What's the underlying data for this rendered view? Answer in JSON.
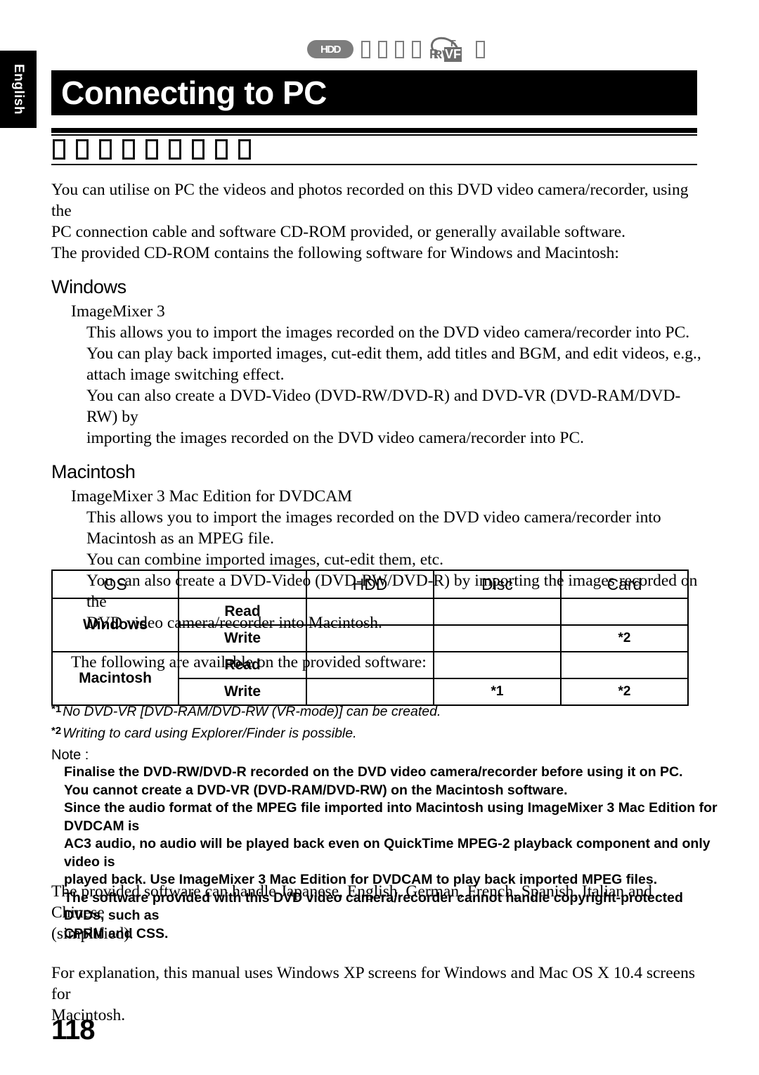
{
  "page": {
    "language_tab": "English",
    "page_number": "118"
  },
  "media_icons": [
    {
      "name": "hdd-badge-icon",
      "label": "HDD",
      "kind": "pill"
    },
    {
      "name": "media-glyph-1-icon",
      "label": "",
      "kind": "tofu"
    },
    {
      "name": "media-glyph-2-icon",
      "label": "",
      "kind": "tofu"
    },
    {
      "name": "media-glyph-3-icon",
      "label": "",
      "kind": "tofu"
    },
    {
      "name": "media-glyph-4-icon",
      "label": "",
      "kind": "tofu"
    },
    {
      "name": "dvd-ram-rw-r-vf-icon",
      "label": "R RW VF F",
      "kind": "combo"
    },
    {
      "name": "media-glyph-5-icon",
      "label": "",
      "kind": "tofu"
    }
  ],
  "header": {
    "title": "Connecting to PC"
  },
  "section_heading": {
    "glyph_count": 9,
    "note": "Heading characters are not rendered (missing glyph boxes)"
  },
  "intro": {
    "lines": [
      "You can utilise on PC the videos and photos recorded on this DVD video camera/recorder, using the",
      "PC connection cable and software CD-ROM provided, or generally available software.",
      "The provided CD-ROM contains the following software for Windows and Macintosh:"
    ]
  },
  "windows_section": {
    "heading": "Windows",
    "product": "ImageMixer 3",
    "details": [
      "This allows you to import the images recorded on the DVD video camera/recorder into PC.",
      "You can play back imported images, cut-edit them, add titles and BGM, and edit videos, e.g.,",
      "attach image switching effect.",
      "You can also create a DVD-Video (DVD-RW/DVD-R) and DVD-VR (DVD-RAM/DVD-RW) by",
      "importing the images recorded on the DVD video camera/recorder into PC."
    ]
  },
  "macintosh_section": {
    "heading": "Macintosh",
    "product": "ImageMixer 3 Mac Edition for DVDCAM",
    "details": [
      "This allows you to import the images recorded on the DVD video camera/recorder into",
      "Macintosh as an MPEG file.",
      "You can combine imported images, cut-edit them, etc.",
      "You can also create a DVD-Video (DVD-RW/DVD-R) by importing the images recorded on the",
      "DVD video camera/recorder into Macintosh."
    ]
  },
  "table_intro": "The following are available on the provided software:",
  "capability_table": {
    "columns": [
      "OS",
      "",
      "HDD",
      "Disc",
      "Card"
    ],
    "rows": [
      {
        "os": "Windows",
        "operation": "Read",
        "hdd": "",
        "disc": "",
        "card": ""
      },
      {
        "os": "Windows",
        "operation": "Write",
        "hdd": "",
        "disc": "",
        "card": "*2"
      },
      {
        "os": "Macintosh",
        "operation": "Read",
        "hdd": "",
        "disc": "",
        "card": ""
      },
      {
        "os": "Macintosh",
        "operation": "Write",
        "hdd": "",
        "disc": "*1",
        "card": "*2"
      }
    ]
  },
  "footnotes": [
    {
      "marker": "*1",
      "text": "No DVD-VR [DVD-RAM/DVD-RW (VR-mode)] can be created."
    },
    {
      "marker": "*2",
      "text": "Writing to card using Explorer/Finder is possible."
    }
  ],
  "note": {
    "label": "Note :",
    "lines": [
      "Finalise the DVD-RW/DVD-R recorded on the DVD video camera/recorder before using it on PC.",
      "You cannot create a DVD-VR (DVD-RAM/DVD-RW) on the Macintosh software.",
      "Since the audio format of the MPEG file imported into Macintosh using ImageMixer 3 Mac Edition for DVDCAM is",
      "AC3 audio, no audio will be played back even on QuickTime MPEG-2 playback component and only video is",
      "played back. Use ImageMixer 3 Mac Edition for DVDCAM to play back imported MPEG files.",
      "The software provided with this DVD video camera/recorder cannot handle copyright-protected DVDs, such as",
      "CPRM and CSS."
    ]
  },
  "tail_paragraphs": [
    [
      "The provided software can handle Japanese, English, German, French, Spanish, Italian and Chinese",
      "(simplified)."
    ],
    [
      "For explanation, this manual uses Windows XP screens for Windows and Mac OS X 10.4 screens for",
      "Macintosh."
    ]
  ]
}
